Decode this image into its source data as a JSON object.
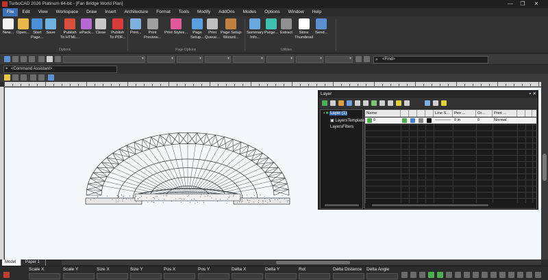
{
  "window": {
    "title": "TurboCAD 2026 Platinum 64-bit - [Fan Bridge World Plan]",
    "minimize": "—",
    "restore": "❐",
    "close": "✕"
  },
  "menu": [
    "File",
    "Edit",
    "View",
    "Workspace",
    "Draw",
    "Insert",
    "Architecture",
    "Format",
    "Tools",
    "Modify",
    "AddOns",
    "Modes",
    "Options",
    "Window",
    "Help"
  ],
  "ribbon": {
    "buttons": [
      {
        "label": "New...",
        "icon": "new-file-icon",
        "color": "#f2f2f2"
      },
      {
        "label": "Open...",
        "icon": "open-folder-icon",
        "color": "#e8b84a"
      },
      {
        "label": "Start\nPage...",
        "icon": "start-page-icon",
        "color": "#4a90d9"
      },
      {
        "label": "Save",
        "icon": "save-icon",
        "color": "#6fb2e0"
      },
      {
        "label": "Publish\nTo HTML...",
        "icon": "publish-html-icon",
        "color": "#d94f3b"
      },
      {
        "label": "ePack...",
        "icon": "epack-icon",
        "color": "#b66ad0"
      },
      {
        "label": "Close",
        "icon": "close-file-icon",
        "color": "#c8c8c8"
      },
      {
        "label": "Publish\nTo PDF...",
        "icon": "publish-pdf-icon",
        "color": "#d93b3b"
      },
      {
        "label": "Print...",
        "icon": "print-icon",
        "color": "#7fb0e0"
      },
      {
        "label": "Print\nPreview...",
        "icon": "print-preview-icon",
        "color": "#a0a0a0"
      },
      {
        "label": "Print Styles...",
        "icon": "print-styles-icon",
        "color": "#e05a9a"
      },
      {
        "label": "Page\nSetup...",
        "icon": "page-setup-icon",
        "color": "#5aa0e0"
      },
      {
        "label": "Print\nQueue...",
        "icon": "print-queue-icon",
        "color": "#c0c0c0"
      },
      {
        "label": "Page Setup\nWizard...",
        "icon": "page-setup-wizard-icon",
        "color": "#c08040"
      },
      {
        "label": "Summary\nInfo...",
        "icon": "summary-info-icon",
        "color": "#6aa8e0"
      },
      {
        "label": "Purge...",
        "icon": "purge-icon",
        "color": "#40c0b0"
      },
      {
        "label": "Extract",
        "icon": "extract-icon",
        "color": "#909090"
      },
      {
        "label": "Store\nThumbnail",
        "icon": "more-icon",
        "color": "#ffffff"
      },
      {
        "label": "Send...",
        "icon": "send-mail-icon",
        "color": "#5a90d0"
      }
    ],
    "groups": [
      "Options",
      "Page Options",
      "Utilities"
    ]
  },
  "toolbar": {
    "find_placeholder": "<Find>",
    "command_assistant": "<Command Assistant>"
  },
  "layer_panel": {
    "title": "Layer",
    "tree": [
      "Layer (1)",
      "LayersTemplates",
      "LayersFilters"
    ],
    "columns": [
      "Name",
      "",
      "",
      "",
      "",
      "Line S...",
      "Pen ...",
      "Or...",
      "Print ..."
    ],
    "row": {
      "name": "0",
      "line": "————",
      "pen": "0 in",
      "order": "0",
      "print": "Normal"
    }
  },
  "tabs": [
    "Model",
    "Paper 1"
  ],
  "status": {
    "fields": [
      "Scale X",
      "Scale Y",
      "Size X",
      "Size Y",
      "Pos X",
      "Pos Y",
      "Delta X",
      "Delta Y",
      "Rot",
      "Delta Distance",
      "Delta Angle"
    ]
  }
}
